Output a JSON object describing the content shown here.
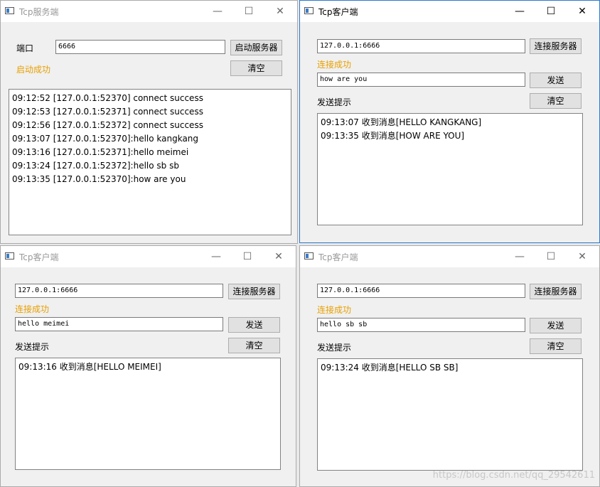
{
  "server": {
    "title": "Tcp服务端",
    "port_label": "端口",
    "port_value": "6666",
    "start_button": "启动服务器",
    "status": "启动成功",
    "clear_button": "清空",
    "log": [
      "09:12:52 [127.0.0.1:52370] connect success",
      "09:12:53 [127.0.0.1:52371] connect success",
      "09:12:56 [127.0.0.1:52372] connect success",
      "09:13:07 [127.0.0.1:52370]:hello kangkang",
      "09:13:16 [127.0.0.1:52371]:hello meimei",
      "09:13:24 [127.0.0.1:52372]:hello sb sb",
      "09:13:35 [127.0.0.1:52370]:how are you"
    ]
  },
  "clients": [
    {
      "title": "Tcp客户端",
      "address": "127.0.0.1:6666",
      "connect_button": "连接服务器",
      "status": "连接成功",
      "message": "how are you",
      "send_button": "发送",
      "hint_label": "发送提示",
      "clear_button": "清空",
      "log": [
        "09:13:07 收到消息[HELLO KANGKANG]",
        "09:13:35 收到消息[HOW ARE YOU]"
      ]
    },
    {
      "title": "Tcp客户端",
      "address": "127.0.0.1:6666",
      "connect_button": "连接服务器",
      "status": "连接成功",
      "message": "hello meimei",
      "send_button": "发送",
      "hint_label": "发送提示",
      "clear_button": "清空",
      "log": [
        "09:13:16 收到消息[HELLO MEIMEI]"
      ]
    },
    {
      "title": "Tcp客户端",
      "address": "127.0.0.1:6666",
      "connect_button": "连接服务器",
      "status": "连接成功",
      "message": "hello sb sb",
      "send_button": "发送",
      "hint_label": "发送提示",
      "clear_button": "清空",
      "log": [
        "09:13:24 收到消息[HELLO SB SB]"
      ]
    }
  ],
  "caption_buttons": {
    "minimize": "—",
    "maximize": "☐",
    "close": "✕"
  },
  "watermark": "https://blog.csdn.net/qq_29542611",
  "colors": {
    "status": "#e8a000",
    "active_border": "#2b79d0"
  }
}
